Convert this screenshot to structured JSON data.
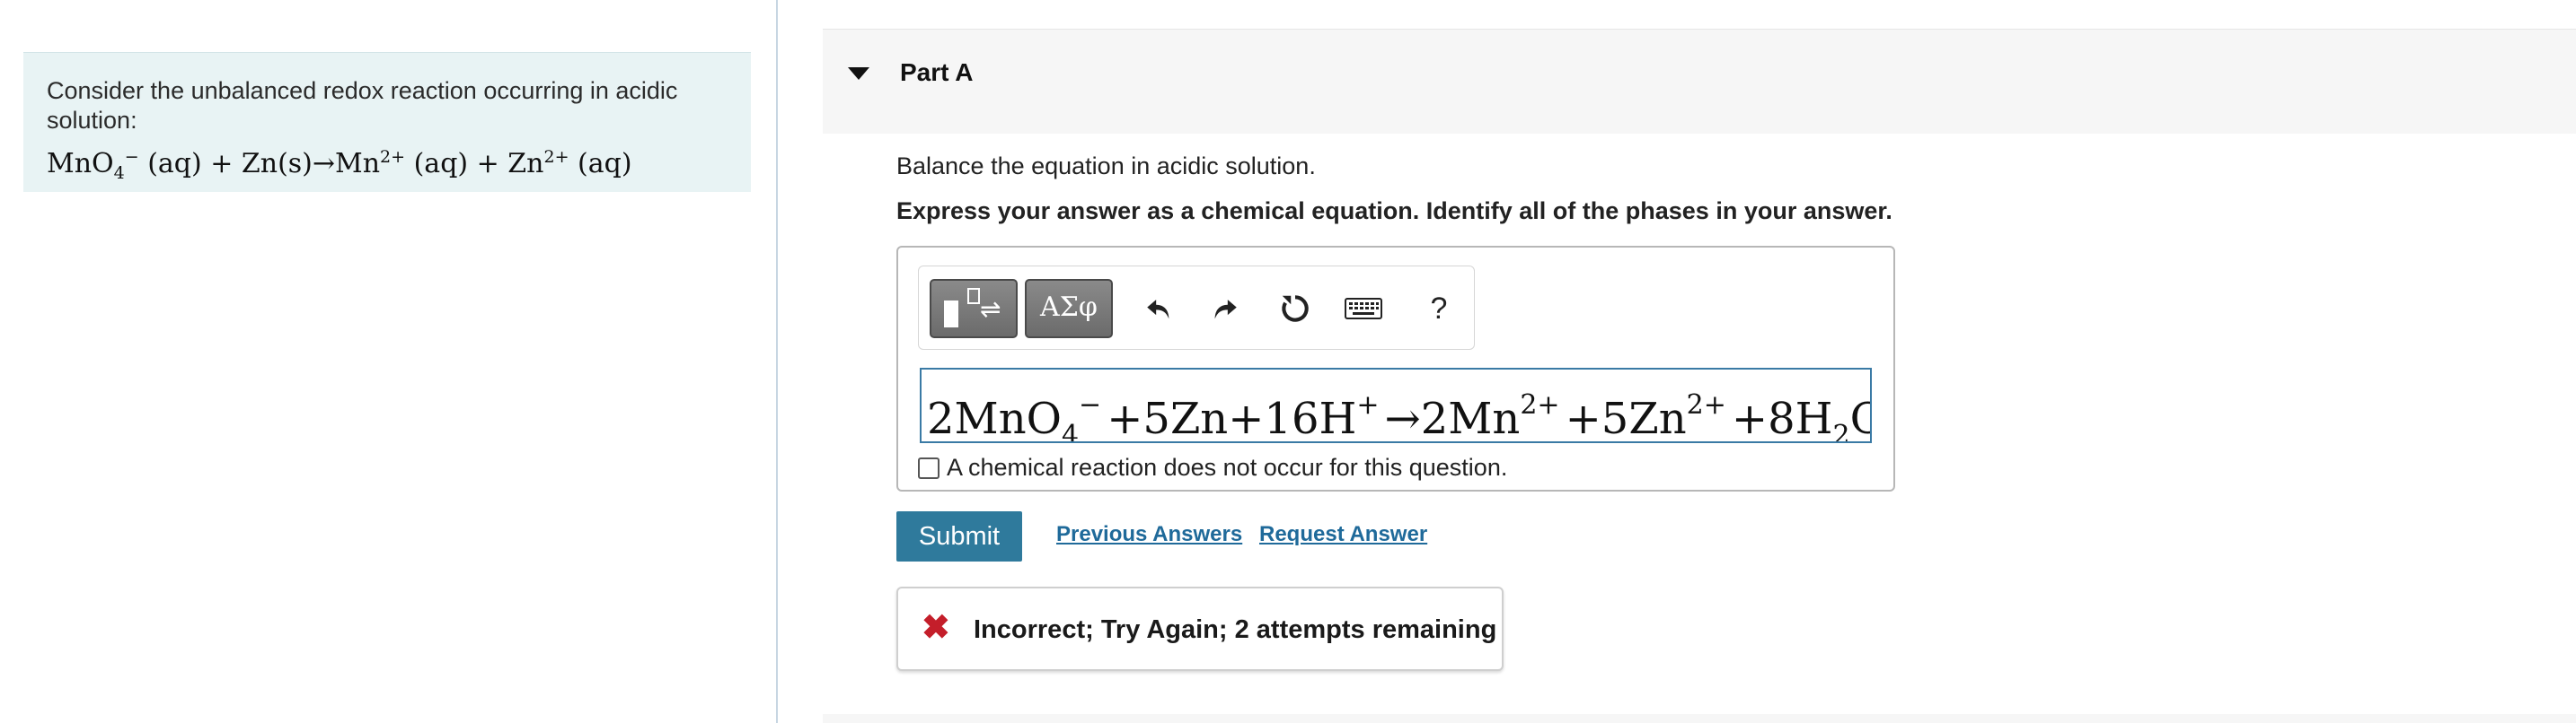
{
  "question": {
    "intro_text": "Consider the unbalanced redox reaction occurring in acidic solution:",
    "equation": {
      "mno": "MnO",
      "mno_sub": "4",
      "mno_sup": "−",
      "phase1": " (aq) + Zn(s)→Mn",
      "mn_sup": "2+",
      "phase2": " (aq) + Zn",
      "zn_sup": "2+",
      "phase3": " (aq)"
    }
  },
  "part": {
    "title": "Part A",
    "instruction": "Balance the equation in acidic solution.",
    "express": "Express your answer as a chemical equation. Identify all of the phases in your answer."
  },
  "toolbar": {
    "templates_icon": "templates-icon",
    "symbols_label": "ΑΣφ",
    "undo_icon": "undo-icon",
    "redo_icon": "redo-icon",
    "reset_icon": "reset-icon",
    "keyboard_icon": "keyboard-icon",
    "help_label": "?"
  },
  "answer": {
    "t1": "2MnO",
    "s1": "4",
    "p1": "−",
    "t2": "+5Zn+16H",
    "p2": "+",
    "t3": "→2Mn",
    "p3": "2+",
    "t4": "+5Zn",
    "p4": "2+",
    "t5": "+8H",
    "s2": "2",
    "t6": "O"
  },
  "no_reaction_label": "A chemical reaction does not occur for this question.",
  "actions": {
    "submit": "Submit",
    "previous_answers": "Previous Answers",
    "request_answer": "Request Answer"
  },
  "feedback": {
    "icon": "x-icon",
    "text": "Incorrect; Try Again; 2 attempts remaining",
    "color": "#c41e2a"
  }
}
